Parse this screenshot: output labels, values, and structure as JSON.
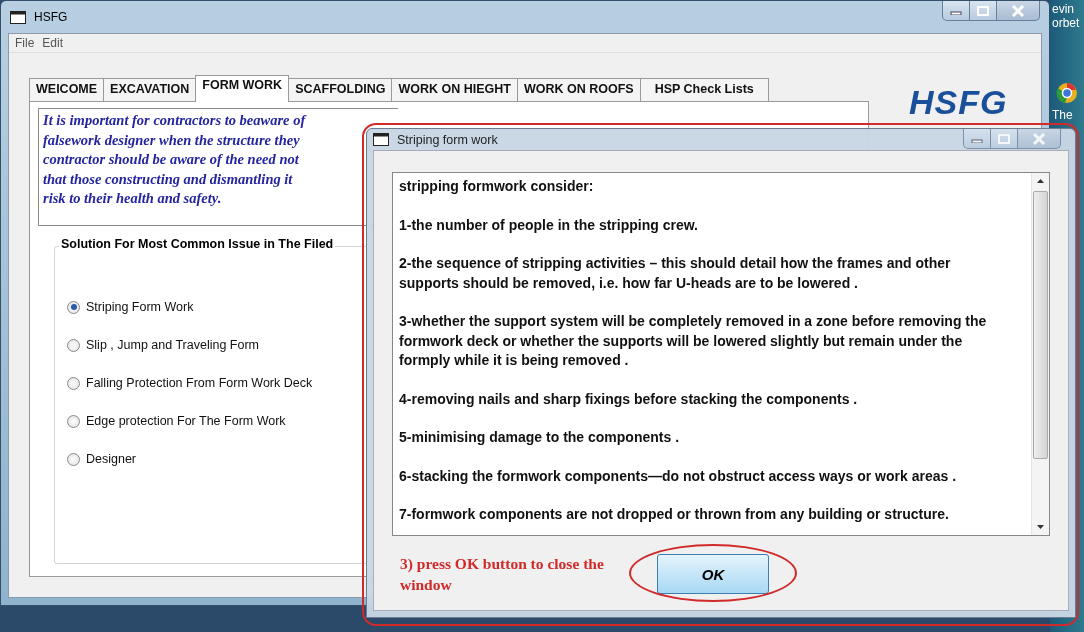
{
  "window": {
    "title": "HSFG",
    "menu": [
      {
        "label": "File"
      },
      {
        "label": "Edit"
      }
    ]
  },
  "tabs": [
    {
      "label": "WEICOME",
      "selected": false
    },
    {
      "label": "EXCAVATION",
      "selected": false
    },
    {
      "label": "FORM WORK",
      "selected": true
    },
    {
      "label": "SCAFFOLDING",
      "selected": false
    },
    {
      "label": "WORK ON HIEGHT",
      "selected": false
    },
    {
      "label": "WORK ON ROOFS",
      "selected": false
    },
    {
      "label": "HSP Check Lists",
      "selected": false
    }
  ],
  "logo": "HSFG",
  "description_lines": [
    "It is important for contractors to beaware of",
    "falsework designer when the structure they",
    "contractor should be aware of the need not",
    "that those constructing and dismantling it",
    "risk to their health and safety."
  ],
  "solutions": {
    "title": "Solution For Most Common Issue in The Filed",
    "options": [
      {
        "label": "Striping Form Work",
        "selected": true
      },
      {
        "label": "Slip , Jump and Traveling Form",
        "selected": false
      },
      {
        "label": "Falling Protection From Form Work Deck",
        "selected": false
      },
      {
        "label": "Edge protection For The Form Work",
        "selected": false
      },
      {
        "label": "Designer",
        "selected": false
      }
    ]
  },
  "dialog": {
    "title": "Striping form work",
    "heading": "stripping formwork consider:",
    "items": [
      "1-the number of people in the stripping crew.",
      "2-the sequence of stripping activities – this should detail how the frames and other supports should be removed, i.e. how far U-heads are to be lowered .",
      "3-whether the support system will be completely removed in a zone before removing the formwork deck or whether the supports will be lowered slightly but remain under the formply while it is being removed .",
      "4-removing nails and sharp fixings before stacking the components .",
      "5-minimising damage to the components .",
      "6-stacking the formwork components—do not obstruct access ways or work areas .",
      "7-formwork components are not dropped or thrown from any building or structure."
    ],
    "button": "OK",
    "annotation": "3) press OK button to close the window"
  },
  "desktop": {
    "texts": [
      "evin",
      "orbet",
      "The"
    ]
  }
}
